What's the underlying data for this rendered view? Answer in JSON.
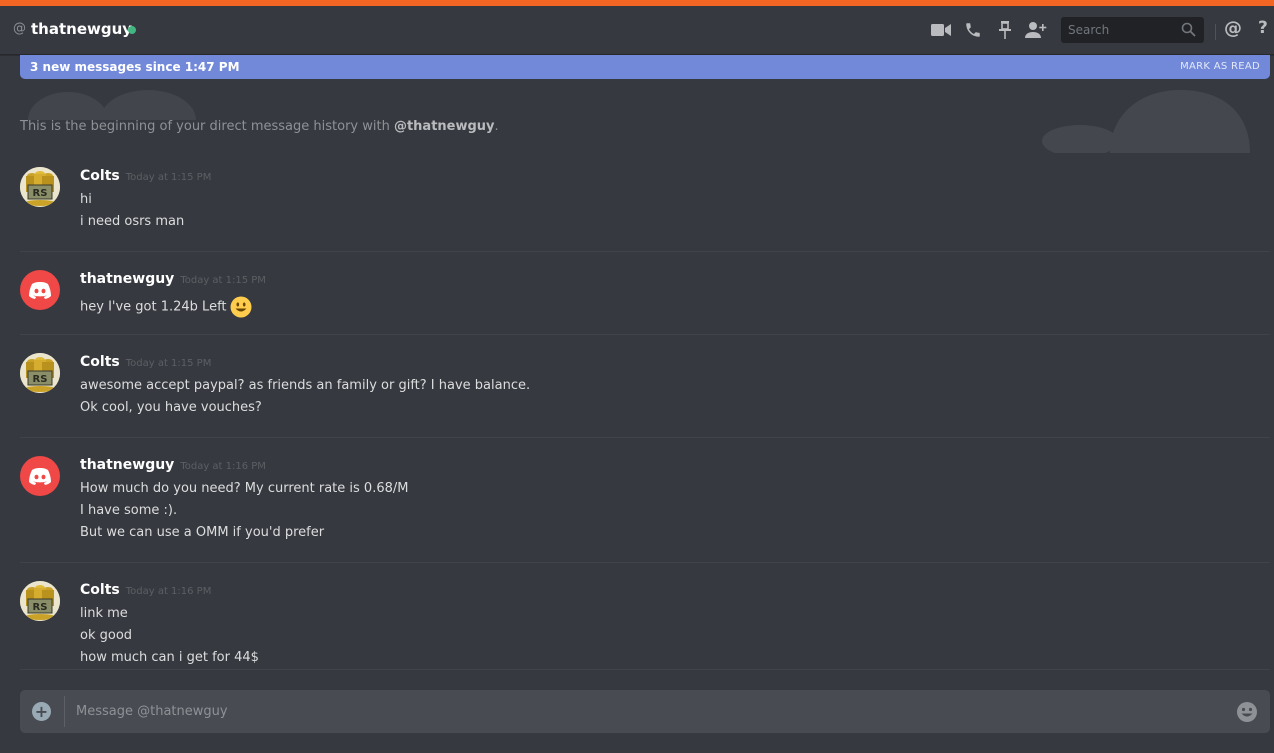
{
  "header": {
    "at_symbol": "@",
    "username": "thatnewguy",
    "search_placeholder": "Search",
    "mention_symbol": "@",
    "help_symbol": "?"
  },
  "new_messages_bar": {
    "text": "3 new messages since 1:47 PM",
    "action": "MARK AS READ"
  },
  "history": {
    "prefix": "This is the beginning of your direct message history with ",
    "user": "@thatnewguy",
    "suffix": "."
  },
  "messages": [
    {
      "author": "Colts",
      "timestamp": "Today at 1:15 PM",
      "lines": [
        "hi",
        "i need osrs man"
      ]
    },
    {
      "author": "thatnewguy",
      "timestamp": "Today at 1:15 PM",
      "lines": [
        "hey I've got 1.24b Left"
      ]
    },
    {
      "author": "Colts",
      "timestamp": "Today at 1:15 PM",
      "lines": [
        "awesome accept paypal? as friends an family or gift? I have balance.",
        "Ok cool, you have vouches?"
      ]
    },
    {
      "author": "thatnewguy",
      "timestamp": "Today at 1:16 PM",
      "lines": [
        "How much do you need? My current rate is 0.68/M",
        "I have some :).",
        "But we can use a OMM if you'd prefer"
      ]
    },
    {
      "author": "Colts",
      "timestamp": "Today at 1:16 PM",
      "lines": [
        "link me",
        "ok good",
        "how much can i get for 44$"
      ]
    }
  ],
  "composer": {
    "placeholder": "Message @thatnewguy"
  },
  "colors": {
    "accent": "#7289da",
    "top_stripe": "#f26522",
    "online": "#43b581",
    "discord_avatar": "#f04747"
  }
}
